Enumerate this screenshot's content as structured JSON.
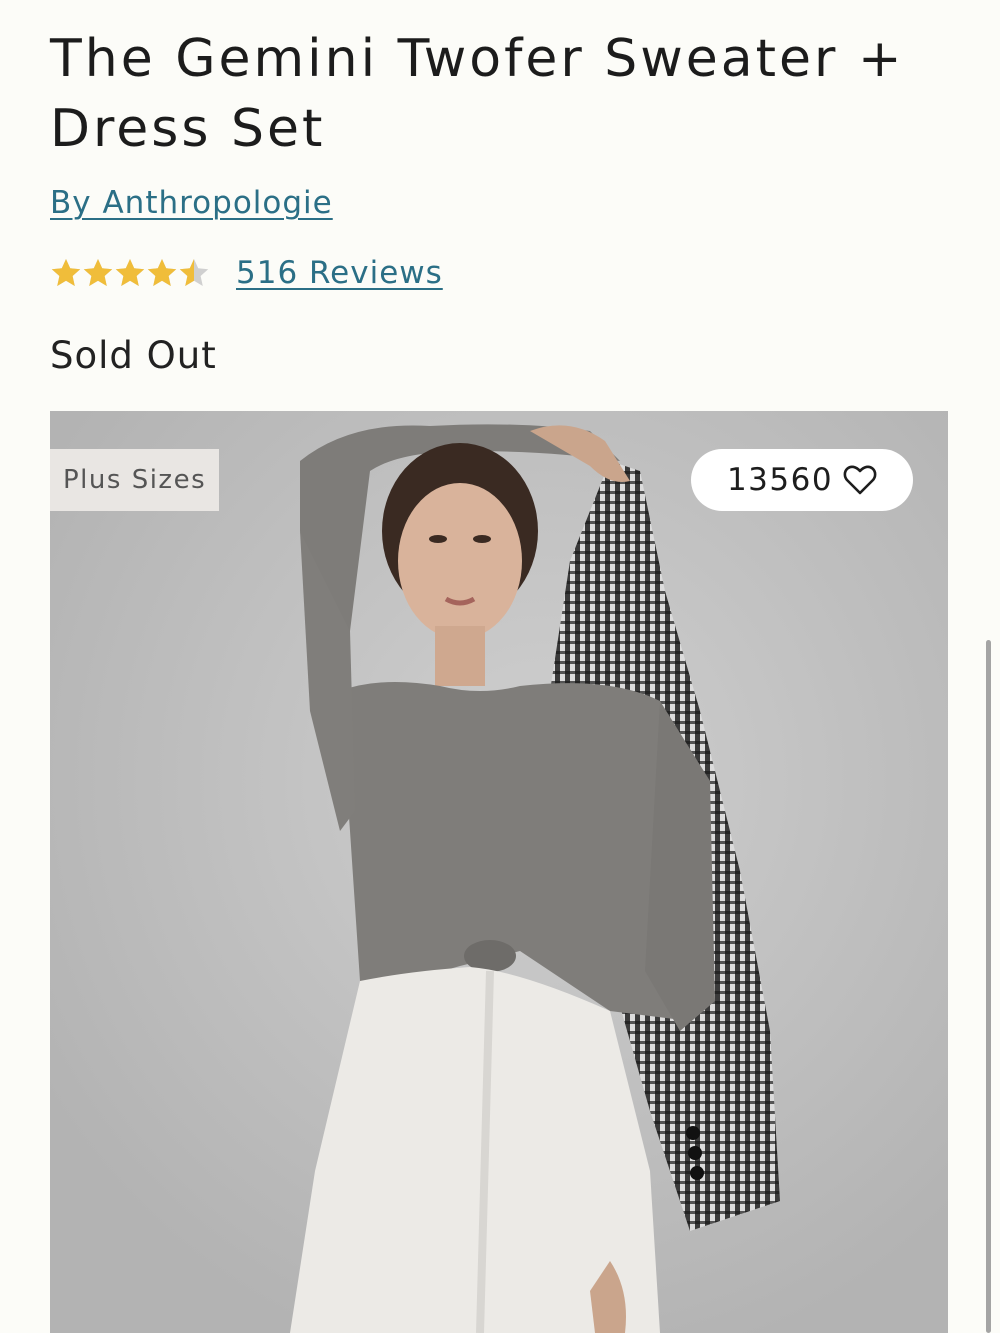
{
  "product": {
    "title": "The Gemini Twofer Sweater + Dress Set",
    "brand_link": "By Anthropologie",
    "rating": 4.5,
    "rating_max": 5,
    "reviews_link": "516 Reviews",
    "availability": "Sold Out"
  },
  "image": {
    "badge": "Plus Sizes",
    "favorites_count": "13560",
    "favorite_icon": "heart-outline-icon"
  },
  "colors": {
    "link": "#2b6f86",
    "star_filled": "#f0bd3a",
    "star_empty": "#d0d0d0",
    "background": "#fcfcf8"
  }
}
